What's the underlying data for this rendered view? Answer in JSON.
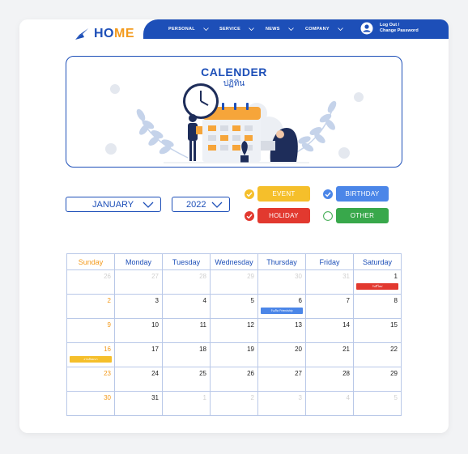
{
  "colors": {
    "primary": "#1d4fb8",
    "accent": "#f39a1c",
    "event": "#f5bf2b",
    "birthday": "#4b86e8",
    "holiday": "#e2392f",
    "other": "#38a84b"
  },
  "header": {
    "logo_part1": "HO",
    "logo_part2": "ME",
    "nav": [
      {
        "label": "PERSONAL"
      },
      {
        "label": "SERVICE"
      },
      {
        "label": "NEWS"
      },
      {
        "label": "COMPANY"
      }
    ],
    "user_line1": "Log Out /",
    "user_line2": "Change Password"
  },
  "banner": {
    "title": "CALENDER",
    "subtitle": "ปฏิทิน"
  },
  "filters": {
    "month": "JANUARY",
    "year": "2022"
  },
  "legend": [
    {
      "label": "EVENT",
      "color": "#f5bf2b",
      "text_color": "#ffffff"
    },
    {
      "label": "BIRTHDAY",
      "color": "#4b86e8",
      "text_color": "#ffffff"
    },
    {
      "label": "HOLIDAY",
      "color": "#e2392f",
      "text_color": "#ffffff"
    },
    {
      "label": "OTHER",
      "color": "#38a84b",
      "text_color": "#ffffff"
    }
  ],
  "calendar": {
    "weekdays": [
      "Sunday",
      "Monday",
      "Tuesday",
      "Wednesday",
      "Thursday",
      "Friday",
      "Saturday"
    ],
    "weeks": [
      [
        {
          "d": "26",
          "m": true
        },
        {
          "d": "27",
          "m": true
        },
        {
          "d": "28",
          "m": true
        },
        {
          "d": "29",
          "m": true
        },
        {
          "d": "30",
          "m": true
        },
        {
          "d": "31",
          "m": true
        },
        {
          "d": "1",
          "event": "วันปีใหม่",
          "ecolor": "#e2392f"
        }
      ],
      [
        {
          "d": "2"
        },
        {
          "d": "3"
        },
        {
          "d": "4"
        },
        {
          "d": "5"
        },
        {
          "d": "6",
          "event": "วันเกิด Friendship",
          "ecolor": "#4b86e8"
        },
        {
          "d": "7"
        },
        {
          "d": "8"
        }
      ],
      [
        {
          "d": "9"
        },
        {
          "d": "10"
        },
        {
          "d": "11"
        },
        {
          "d": "12"
        },
        {
          "d": "13"
        },
        {
          "d": "14"
        },
        {
          "d": "15"
        }
      ],
      [
        {
          "d": "16",
          "event": "งานสัมมนา",
          "ecolor": "#f5bf2b"
        },
        {
          "d": "17"
        },
        {
          "d": "18"
        },
        {
          "d": "19"
        },
        {
          "d": "20"
        },
        {
          "d": "21"
        },
        {
          "d": "22"
        }
      ],
      [
        {
          "d": "23"
        },
        {
          "d": "24"
        },
        {
          "d": "25"
        },
        {
          "d": "26"
        },
        {
          "d": "27"
        },
        {
          "d": "28"
        },
        {
          "d": "29"
        }
      ],
      [
        {
          "d": "30"
        },
        {
          "d": "31"
        },
        {
          "d": "1",
          "m": true
        },
        {
          "d": "2",
          "m": true
        },
        {
          "d": "3",
          "m": true
        },
        {
          "d": "4",
          "m": true
        },
        {
          "d": "5",
          "m": true
        }
      ]
    ]
  }
}
